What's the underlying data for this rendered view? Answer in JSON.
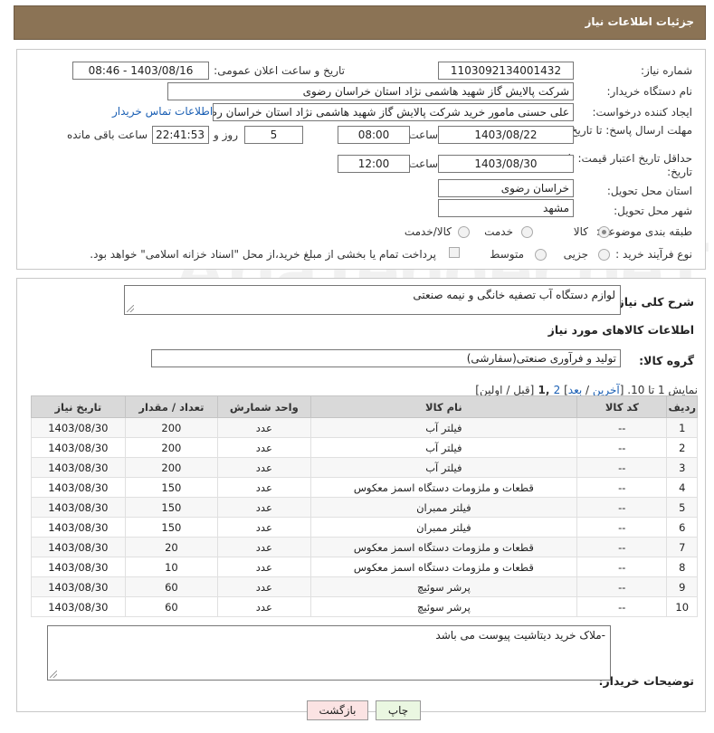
{
  "header": {
    "title": "جزئیات اطلاعات نیاز"
  },
  "form": {
    "need_number_label": "شماره نیاز:",
    "need_number": "1103092134001432",
    "announce_label": "تاریخ و ساعت اعلان عمومی:",
    "announce_value": "1403/08/16 - 08:46",
    "buyer_org_label": "نام دستگاه خریدار:",
    "buyer_org": "شرکت پالایش گاز شهید هاشمی نژاد   استان خراسان رضوی",
    "requester_label": "ایجاد کننده درخواست:",
    "requester": "علی حسنی مامور خرید شرکت پالایش گاز شهید هاشمی نژاد   استان خراسان رضوی",
    "contact_link": "اطلاعات تماس خریدار",
    "deadline_label": "مهلت ارسال پاسخ: تا تاریخ:",
    "deadline_date": "1403/08/22",
    "time_label": "ساعت",
    "deadline_time": "08:00",
    "days_value": "5",
    "days_label": "روز و",
    "remaining_time": "22:41:53",
    "remaining_label": "ساعت باقی مانده",
    "validity_label": "حداقل تاریخ اعتبار قیمت: تا تاریخ:",
    "validity_date": "1403/08/30",
    "validity_time": "12:00",
    "province_label": "استان محل تحویل:",
    "province": "خراسان رضوی",
    "city_label": "شهر محل تحویل:",
    "city": "مشهد",
    "category_label": "طبقه بندی موضوعی:",
    "category_options": [
      "کالا",
      "خدمت",
      "کالا/خدمت"
    ],
    "process_label": "نوع فرآیند خرید :",
    "process_options": [
      "جزیی",
      "متوسط"
    ],
    "payment_note": "پرداخت تمام یا بخشی از مبلغ خرید،از محل \"اسناد خزانه اسلامی\" خواهد بود."
  },
  "summary": {
    "label": "شرح کلی نیاز:",
    "value": "لوازم دستگاه آب تصفیه خانگی و نیمه صنعتی",
    "goods_info_title": "اطلاعات کالاهای مورد نیاز",
    "goods_group_label": "گروه کالا:",
    "goods_group": "تولید و فرآوری صنعتی(سفارشی)"
  },
  "pagination": {
    "text_prefix": "نمایش 1 تا 10. [",
    "last": "آخرین",
    "slash": " / ",
    "next": "بعد",
    "bracket_close": "]",
    "page2": "2",
    "pages_current": " ,1 ",
    "rest": "[قبل / اولین]"
  },
  "table": {
    "headers": [
      "ردیف",
      "کد کالا",
      "نام کالا",
      "واحد شمارش",
      "تعداد / مقدار",
      "تاریخ نیاز"
    ],
    "rows": [
      [
        "1",
        "--",
        "فیلتر آب",
        "عدد",
        "200",
        "1403/08/30"
      ],
      [
        "2",
        "--",
        "فیلتر آب",
        "عدد",
        "200",
        "1403/08/30"
      ],
      [
        "3",
        "--",
        "فیلتر آب",
        "عدد",
        "200",
        "1403/08/30"
      ],
      [
        "4",
        "--",
        "قطعات و ملزومات دستگاه اسمز معکوس",
        "عدد",
        "150",
        "1403/08/30"
      ],
      [
        "5",
        "--",
        "فیلتر ممبران",
        "عدد",
        "150",
        "1403/08/30"
      ],
      [
        "6",
        "--",
        "فیلتر ممبران",
        "عدد",
        "150",
        "1403/08/30"
      ],
      [
        "7",
        "--",
        "قطعات و ملزومات دستگاه اسمز معکوس",
        "عدد",
        "20",
        "1403/08/30"
      ],
      [
        "8",
        "--",
        "قطعات و ملزومات دستگاه اسمز معکوس",
        "عدد",
        "10",
        "1403/08/30"
      ],
      [
        "9",
        "--",
        "پرشر سوئیچ",
        "عدد",
        "60",
        "1403/08/30"
      ],
      [
        "10",
        "--",
        "پرشر سوئیچ",
        "عدد",
        "60",
        "1403/08/30"
      ]
    ]
  },
  "buyer_notes": {
    "label": "توضیحات خریدار:",
    "value": "-ملاک خرید دیتاشیت پیوست می باشد"
  },
  "buttons": {
    "print": "چاپ",
    "back": "بازگشت"
  },
  "watermark": "AriaTender.neT",
  "colors": {
    "header_bg": "#8b7355",
    "link": "#1a5fb4",
    "print_bg": "#eaf7e1",
    "back_bg": "#fbe3e3"
  }
}
